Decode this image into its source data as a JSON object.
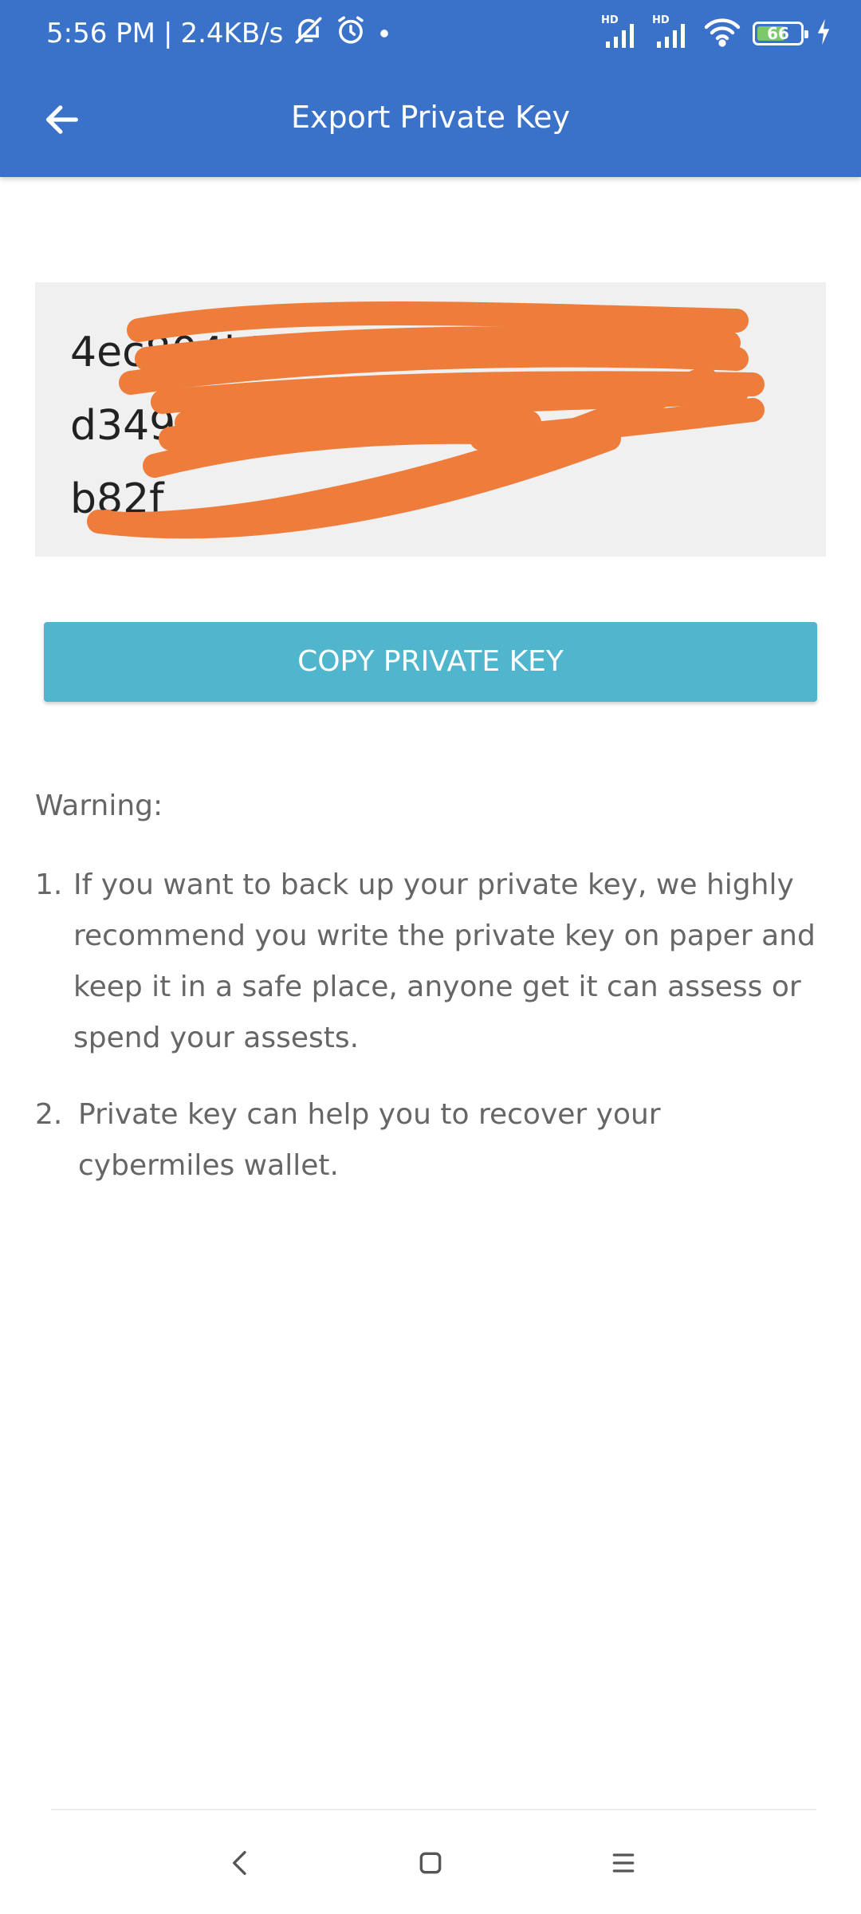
{
  "status_bar": {
    "time": "5:56 PM",
    "separator": "|",
    "network_speed": "2.4KB/s",
    "battery_level": 66,
    "battery_label": "66",
    "network_badges": [
      "HD",
      "HD"
    ],
    "icons": [
      "mute-icon",
      "alarm-icon",
      "dot-icon",
      "signal-icon",
      "signal-icon",
      "wifi-icon",
      "battery-icon",
      "charging-icon"
    ]
  },
  "toolbar": {
    "title": "Export Private Key",
    "back_icon": "arrow-left-icon"
  },
  "private_key": {
    "visible_fragments": "4ec804b7\nd349\nb82f",
    "redacted": true
  },
  "actions": {
    "copy_label": "COPY PRIVATE KEY"
  },
  "warning": {
    "title": "Warning:",
    "items": [
      {
        "number": "1.",
        "text": "If you want to back up your private key, we highly recommend you write the private key on paper and keep it in a safe place, anyone get it can assess or spend your assests."
      },
      {
        "number": "2.",
        "text": "Private key can help you to recover your cybermiles wallet."
      }
    ]
  },
  "nav_bar": {
    "icons": [
      "nav-back-icon",
      "nav-home-icon",
      "nav-recents-icon"
    ]
  },
  "colors": {
    "primary": "#3a72c9",
    "button": "#4fb6cd",
    "redaction": "#ee7d3c",
    "key_background": "#f0f0f0",
    "warning_text": "#666666"
  }
}
